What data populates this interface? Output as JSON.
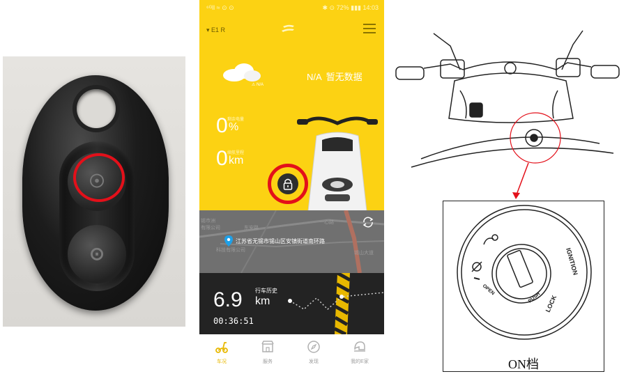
{
  "phone": {
    "status": {
      "left": "⁶ᴳll ≈ ⊙ ⊙",
      "right": "✱ ⊙ 72% ▮▮▮ 14:03"
    },
    "vehicle_selector": "▾ E1 R",
    "weather": {
      "badge": "⚠ N/A",
      "value": "N/A",
      "desc": "暂无数据"
    },
    "battery": {
      "value": "0",
      "unit": "%",
      "label": "剩余电量"
    },
    "range": {
      "value": "0",
      "unit": "km",
      "label": "续航里程"
    },
    "map": {
      "address": "江苏省无锡市锡山区安镇街道南环路",
      "labels": [
        "锡市洲",
        "有限公司",
        "东安路",
        "科技有限公司",
        "一心路",
        "锡山大道"
      ]
    },
    "history": {
      "label": "行车历史",
      "distance": "6.9",
      "unit": "km",
      "duration": "00:36:51"
    },
    "tabs": [
      {
        "label": "车况",
        "icon": "scooter-icon",
        "active": true
      },
      {
        "label": "服务",
        "icon": "shop-icon",
        "active": false
      },
      {
        "label": "发现",
        "icon": "compass-icon",
        "active": false
      },
      {
        "label": "我的E家",
        "icon": "helmet-icon",
        "active": false
      }
    ]
  },
  "ignition": {
    "label": "ON档",
    "positions": [
      "IGNITION",
      "LOCK",
      "PUSH",
      "OPEN"
    ]
  },
  "colors": {
    "app_yellow": "#fcd213",
    "highlight_red": "#e3101a",
    "history_bg": "#232323"
  }
}
